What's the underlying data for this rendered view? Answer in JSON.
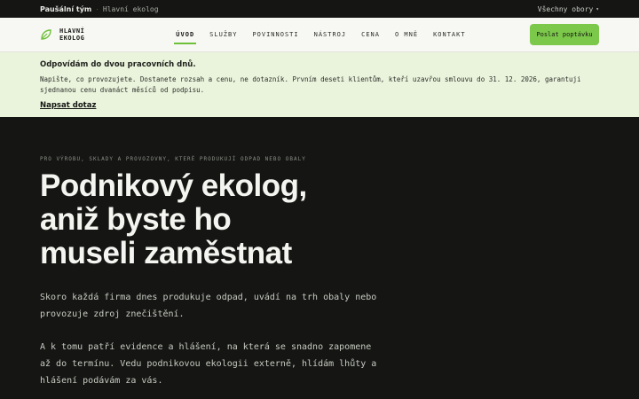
{
  "topbar": {
    "breadcrumb_main": "Paušální tým",
    "breadcrumb_sub": "Hlavní ekolog",
    "areas_dropdown": "Všechny obory"
  },
  "logo": {
    "line1": "HLAVNÍ",
    "line2": "EKOLOG",
    "icon": "leaf-icon",
    "accent_color": "#7cc84a"
  },
  "nav": {
    "items": [
      "ÚVOD",
      "SLUŽBY",
      "POVINNOSTI",
      "NÁSTROJ",
      "CENA",
      "O MNĚ",
      "KONTAKT"
    ],
    "active_index": 0,
    "cta_label": "Poslat poptávku"
  },
  "notice": {
    "title": "Odpovídám do dvou pracovních dnů.",
    "text": "Napište, co provozujete. Dostanete rozsah a cenu, ne dotazník. Prvním deseti klientům, kteří uzavřou smlouvu do 31. 12. 2026, garantuji sjednanou cenu dvanáct měsíců od podpisu.",
    "link": "Napsat dotaz"
  },
  "hero": {
    "eyebrow": "Pro výrobu, sklady a provozovny, které produkují odpad nebo obaly",
    "headline_line1": "Podnikový ekolog,",
    "headline_line2": "aniž byste ho",
    "headline_line3": "museli zaměstnat",
    "paragraph1": "Skoro každá firma dnes produkuje odpad, uvádí na trh obaly nebo provozuje zdroj znečištění.",
    "paragraph2": "A k tomu patří evidence a hlášení, na která se snadno zapomene až do termínu. Vedu podnikovou ekologii externě, hlídám lhůty a hlášení podávám za vás."
  }
}
